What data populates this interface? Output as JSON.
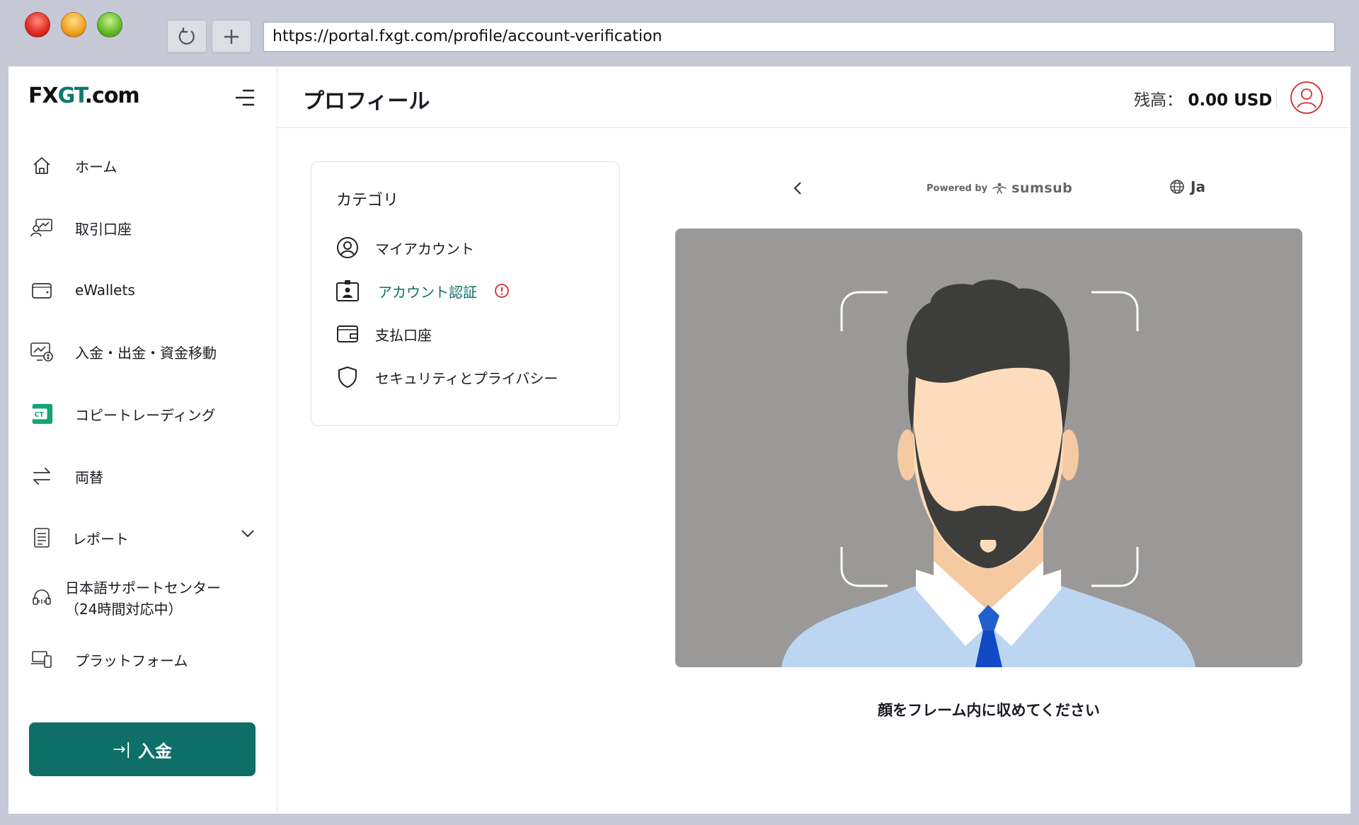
{
  "browser": {
    "url": "https://portal.fxgt.com/profile/account-verification"
  },
  "sidebar": {
    "logo": {
      "part1": "FX",
      "part2": "GT",
      "part3": ".com"
    },
    "items": [
      {
        "label": "ホーム",
        "icon": "home-icon"
      },
      {
        "label": "取引口座",
        "icon": "trading-account-icon"
      },
      {
        "label": "eWallets",
        "icon": "wallet-icon"
      },
      {
        "label": "入金・出金・資金移動",
        "icon": "funds-transfer-icon"
      },
      {
        "label": "コピートレーディング",
        "icon": "copy-trading-icon"
      },
      {
        "label": "両替",
        "icon": "exchange-icon"
      },
      {
        "label": "レポート",
        "icon": "report-icon"
      },
      {
        "label": "日本語サポートセンター",
        "label2": "（24時間対応中）",
        "icon": "headset-icon"
      },
      {
        "label": "プラットフォーム",
        "icon": "platform-icon"
      }
    ],
    "copy_trading_badge": "CT",
    "deposit_button": {
      "arrow": "→|",
      "label": "入金"
    }
  },
  "header": {
    "title": "プロフィール",
    "balance_label": "残高：",
    "balance_value": "0.00 USD"
  },
  "category": {
    "title": "カテゴリ",
    "items": [
      {
        "label": "マイアカウント",
        "icon": "user-circle-icon"
      },
      {
        "label": "アカウント認証",
        "icon": "id-card-icon",
        "active": true
      },
      {
        "label": "支払口座",
        "icon": "wallet-icon"
      },
      {
        "label": "セキュリティとプライバシー",
        "icon": "shield-icon"
      }
    ]
  },
  "verification": {
    "powered_by": "Powered by",
    "brand": "sumsub",
    "language": "Ja",
    "instruction": "顔をフレーム内に収めてください"
  },
  "colors": {
    "accent": "#0e6e68",
    "warning": "#d32f2f",
    "camera_bg": "#9a9998"
  }
}
